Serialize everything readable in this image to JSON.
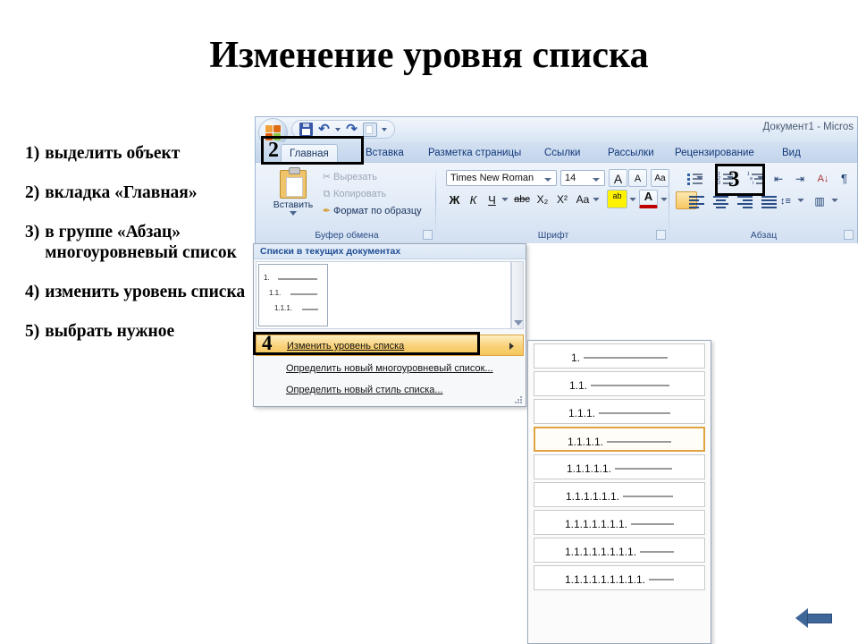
{
  "slide": {
    "title": "Изменение уровня списка",
    "steps": [
      {
        "num": "1)",
        "text": "выделить объект"
      },
      {
        "num": "2)",
        "text": " вкладка «Главная»"
      },
      {
        "num": "3)",
        "text": "в группе «Абзац» многоуровневый список"
      },
      {
        "num": "4)",
        "text": "изменить уровень списка"
      },
      {
        "num": "5)",
        "text": "выбрать нужное"
      }
    ],
    "back_arrow": "back-arrow-icon"
  },
  "word": {
    "titlebar": {
      "document_title": "Документ1 - Micros"
    },
    "quick_access": [
      {
        "name": "save-icon",
        "label": "Сохранить"
      },
      {
        "name": "undo-icon",
        "label": "Отменить"
      },
      {
        "name": "undo-dropdown-icon",
        "label": ""
      },
      {
        "name": "redo-icon",
        "label": "Вернуть"
      },
      {
        "name": "print-preview-icon",
        "label": "Предварительный просмотр"
      },
      {
        "name": "customize-qat-icon",
        "label": ""
      }
    ],
    "tabs": [
      {
        "label": "Главная",
        "active": true
      },
      {
        "label": "Вставка",
        "active": false
      },
      {
        "label": "Разметка страницы",
        "active": false
      },
      {
        "label": "Ссылки",
        "active": false
      },
      {
        "label": "Рассылки",
        "active": false
      },
      {
        "label": "Рецензирование",
        "active": false
      },
      {
        "label": "Вид",
        "active": false
      }
    ],
    "groups": {
      "clipboard": {
        "label": "Буфер обмена",
        "paste_label": "Вставить",
        "items": [
          {
            "label": "Вырезать",
            "icon": "scissors-icon"
          },
          {
            "label": "Копировать",
            "icon": "copy-icon"
          },
          {
            "label": "Формат по образцу",
            "icon": "format-painter-icon"
          }
        ]
      },
      "font": {
        "label": "Шрифт",
        "font_name": "Times New Roman",
        "font_size": "14",
        "buttons": [
          {
            "label": "A",
            "name": "grow-font-button"
          },
          {
            "label": "A",
            "name": "shrink-font-button"
          },
          {
            "label": "Aa",
            "name": "clear-formatting-button"
          },
          {
            "label": "Ж",
            "name": "bold-button"
          },
          {
            "label": "К",
            "name": "italic-button"
          },
          {
            "label": "Ч",
            "name": "underline-button"
          },
          {
            "label": "abc",
            "name": "strikethrough-button"
          },
          {
            "label": "X₂",
            "name": "subscript-button"
          },
          {
            "label": "X²",
            "name": "superscript-button"
          },
          {
            "label": "Aa",
            "name": "change-case-button"
          },
          {
            "label": "ab",
            "name": "highlight-button"
          },
          {
            "label": "A",
            "name": "font-color-button"
          }
        ]
      },
      "paragraph": {
        "label": "Абзац",
        "buttons": [
          {
            "name": "bullets-button"
          },
          {
            "name": "numbering-button"
          },
          {
            "name": "multilevel-list-button"
          },
          {
            "name": "decrease-indent-button"
          },
          {
            "name": "increase-indent-button"
          },
          {
            "name": "sort-button"
          },
          {
            "name": "show-marks-button"
          },
          {
            "name": "align-left-button"
          },
          {
            "name": "align-center-button"
          },
          {
            "name": "align-right-button"
          },
          {
            "name": "align-justify-button"
          },
          {
            "name": "line-spacing-button"
          },
          {
            "name": "shading-button"
          },
          {
            "name": "borders-button"
          }
        ]
      }
    }
  },
  "gallery": {
    "header": "Списки в текущих документах",
    "thumbnail_levels": [
      "1.",
      "1.1.",
      "1.1.1."
    ],
    "menu_items": [
      {
        "label": "Изменить уровень списка",
        "underline": "И",
        "highlighted": true,
        "has_submenu": true
      },
      {
        "label": "Определить новый многоуровневый список...",
        "underline": "О",
        "highlighted": false,
        "has_submenu": false
      },
      {
        "label": "Определить новый стиль списка...",
        "underline": "О",
        "highlighted": false,
        "has_submenu": false
      }
    ]
  },
  "level_flyout": {
    "items": [
      {
        "label": "1.",
        "selected": false
      },
      {
        "label": "1.1.",
        "selected": false
      },
      {
        "label": "1.1.1.",
        "selected": false
      },
      {
        "label": "1.1.1.1.",
        "selected": true
      },
      {
        "label": "1.1.1.1.1.",
        "selected": false
      },
      {
        "label": "1.1.1.1.1.1.",
        "selected": false
      },
      {
        "label": "1.1.1.1.1.1.1.",
        "selected": false
      },
      {
        "label": "1.1.1.1.1.1.1.1.",
        "selected": false
      },
      {
        "label": "1.1.1.1.1.1.1.1.1.",
        "selected": false
      }
    ]
  },
  "callouts": [
    {
      "number": "2",
      "target": "home-tab"
    },
    {
      "number": "3",
      "target": "multilevel-list-button"
    },
    {
      "number": "4",
      "target": "change-list-level-menu-item"
    }
  ],
  "colors": {
    "title_text": "#000000",
    "ribbon_blue": "#d3e0f1",
    "tab_text": "#11387a",
    "highlight_orange": "#f5c65d",
    "selection_border": "#e0a33c",
    "arrow_blue": "#3f6699"
  }
}
